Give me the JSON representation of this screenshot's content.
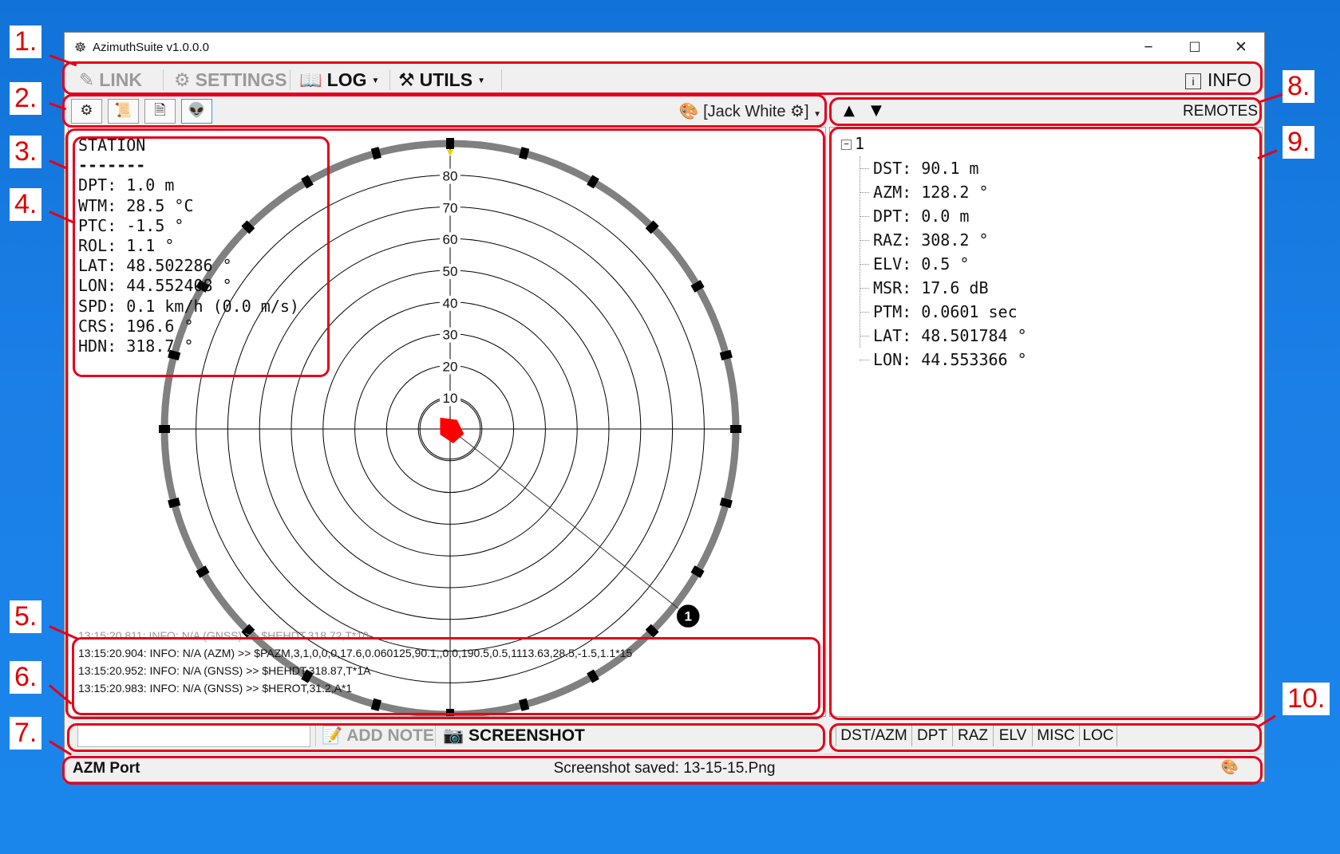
{
  "window": {
    "title": "AzimuthSuite v1.0.0.0",
    "minimize": "−",
    "maximize": "☐",
    "close": "✕"
  },
  "menu": {
    "link": "LINK",
    "settings": "SETTINGS",
    "log": "LOG",
    "utils": "UTILS",
    "info": "INFO",
    "icons": {
      "link": "wrench-icon",
      "settings": "gear-icon",
      "log": "book-icon",
      "utils": "tools-icon",
      "info": "info-icon"
    }
  },
  "toolbar": {
    "buttons": [
      "settings-gear-icon",
      "script-icon",
      "document-icon",
      "alien-icon"
    ],
    "theme_label": "[Jack White",
    "theme_suffix": "]"
  },
  "remotes_bar": {
    "up": "▲",
    "down": "▼",
    "label": "REMOTES"
  },
  "station": {
    "title": "STATION",
    "underline": "-------",
    "lines": [
      "DPT: 1.0 m",
      "WTM: 28.5 °C",
      "PTC: -1.5 °",
      "ROL: 1.1 °",
      "LAT: 48.502286 °",
      "LON: 44.552408 °",
      "SPD: 0.1 km/h (0.0 m/s)",
      "CRS: 196.6 °",
      "HDN: 318.7 °"
    ]
  },
  "plot": {
    "range_labels": [
      "10",
      "20",
      "30",
      "40",
      "50",
      "60",
      "70",
      "80"
    ],
    "remote_marker": "1",
    "remote_azimuth_deg": 128.2,
    "remote_distance_m": 90.1,
    "heading_deg": 318.7,
    "colors": {
      "ring": "#808080",
      "station": "#ff0000",
      "grid": "#000000"
    }
  },
  "log": [
    "13:15:20.811: INFO: N/A (GNSS) >> $HEHDT,318.72,T*10",
    "13:15:20.904: INFO: N/A (AZM) >> $PAZM,3,1,0,0,0,17.6,0.060125,90.1,,0.0,190.5,0.5,1113.63,28.5,-1.5,1.1*15",
    "13:15:20.952: INFO: N/A (GNSS) >> $HEHDT,318.87,T*1A",
    "13:15:20.983: INFO: N/A (GNSS) >> $HEROT,31.2,A*1"
  ],
  "remotes": {
    "root": "1",
    "items": [
      "DST: 90.1 m",
      "AZM: 128.2 °",
      "DPT: 0.0 m",
      "RAZ: 308.2 °",
      "ELV: 0.5 °",
      "MSR: 17.6 dB",
      "PTM: 0.0601 sec",
      "LAT: 48.501784 °",
      "LON: 44.553366 °"
    ]
  },
  "note_bar": {
    "add_note": "ADD NOTE",
    "screenshot": "SCREENSHOT"
  },
  "tabs": [
    "DST/AZM",
    "DPT",
    "RAZ",
    "ELV",
    "MISC",
    "LOC"
  ],
  "status": {
    "port": "AZM Port",
    "message": "Screenshot saved: 13-15-15.Png"
  },
  "callouts": [
    "1.",
    "2.",
    "3.",
    "4.",
    "5.",
    "6.",
    "7.",
    "8.",
    "9.",
    "10."
  ]
}
